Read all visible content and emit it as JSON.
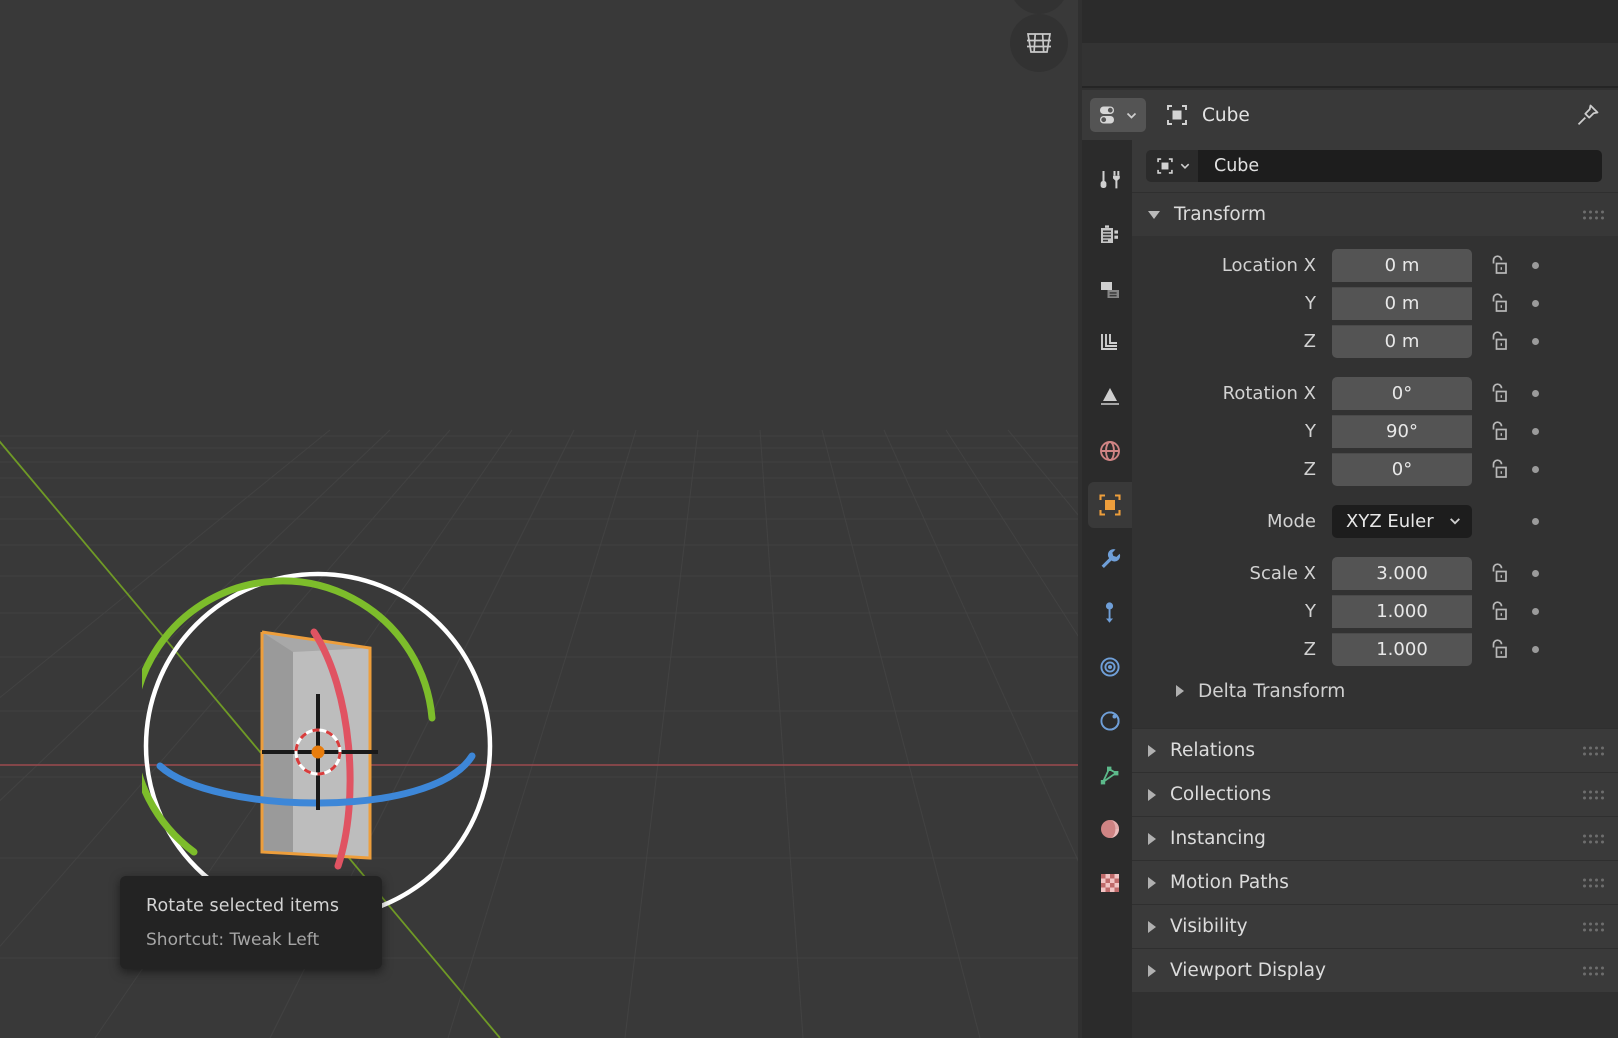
{
  "viewport": {
    "name": "3d-viewport",
    "background_color": "#393939",
    "grid_color": "#414141",
    "axis_x_color": "#9c4a4f",
    "axis_y_color": "#7aa32f",
    "gizmo": {
      "type": "rotate-gizmo",
      "outer_circle_color": "#ffffff",
      "arc_x_color": "#e05362",
      "arc_y_color": "#7dbd2b",
      "arc_z_color": "#3d87d8",
      "object_outline_color": "#ed9e3c",
      "object_fill_color": "#b0b0b0",
      "cursor_color": "#e87d0d"
    },
    "nav_icons": {
      "toggle_grid": "grid-icon",
      "zoom": "zoom-icon"
    }
  },
  "tooltip": {
    "title": "Rotate selected items",
    "shortcut": "Shortcut: Tweak Left"
  },
  "properties": {
    "editor_type_icon": "properties-editor-icon",
    "breadcrumb": {
      "object_icon": "object-icon",
      "object_name": "Cube"
    },
    "pin_icon": "pin-icon",
    "id_block": {
      "type_icon": "object-icon",
      "name": "Cube"
    },
    "tabs": [
      {
        "id": "tool",
        "icon": "tool-icon",
        "label": "Tool",
        "active": false,
        "color": "#d4d4d4"
      },
      {
        "id": "render",
        "icon": "render-icon",
        "label": "Render",
        "active": false,
        "color": "#d4d4d4"
      },
      {
        "id": "output",
        "icon": "output-printer-icon",
        "label": "Output",
        "active": false,
        "color": "#d4d4d4"
      },
      {
        "id": "view-layer",
        "icon": "view-layer-icon",
        "label": "View Layer",
        "active": false,
        "color": "#d4d4d4"
      },
      {
        "id": "scene",
        "icon": "scene-cone-icon",
        "label": "Scene",
        "active": false,
        "color": "#d4d4d4"
      },
      {
        "id": "world",
        "icon": "world-globe-icon",
        "label": "World",
        "active": false,
        "color": "#d08080"
      },
      {
        "id": "object",
        "icon": "object-square-icon",
        "label": "Object",
        "active": true,
        "color": "#ed9e3c"
      },
      {
        "id": "modifiers",
        "icon": "wrench-icon",
        "label": "Modifiers",
        "active": false,
        "color": "#6f9fd8"
      },
      {
        "id": "particles",
        "icon": "particles-icon",
        "label": "Particles",
        "active": false,
        "color": "#6f9fd8"
      },
      {
        "id": "physics",
        "icon": "physics-orbit-icon",
        "label": "Physics",
        "active": false,
        "color": "#6f9fd8"
      },
      {
        "id": "constraints",
        "icon": "constraints-icon",
        "label": "Constraints",
        "active": false,
        "color": "#6f9fd8"
      },
      {
        "id": "object-data",
        "icon": "mesh-data-icon",
        "label": "Object Data",
        "active": false,
        "color": "#5cb98a"
      },
      {
        "id": "material",
        "icon": "material-sphere-icon",
        "label": "Material",
        "active": false,
        "color": "#d08080"
      },
      {
        "id": "texture",
        "icon": "texture-checker-icon",
        "label": "Texture",
        "active": false,
        "color": "#d08080"
      }
    ],
    "panels": [
      {
        "id": "transform",
        "title": "Transform",
        "open": true,
        "groups": [
          {
            "id": "location",
            "rows": [
              {
                "label": "Location X",
                "value": "0 m",
                "lock": "unlocked-icon",
                "animate": true
              },
              {
                "label": "Y",
                "value": "0 m",
                "lock": "unlocked-icon",
                "animate": true
              },
              {
                "label": "Z",
                "value": "0 m",
                "lock": "unlocked-icon",
                "animate": true
              }
            ]
          },
          {
            "id": "rotation",
            "rows": [
              {
                "label": "Rotation X",
                "value": "0°",
                "lock": "unlocked-icon",
                "animate": true
              },
              {
                "label": "Y",
                "value": "90°",
                "lock": "unlocked-icon",
                "animate": true
              },
              {
                "label": "Z",
                "value": "0°",
                "lock": "unlocked-icon",
                "animate": true
              }
            ]
          },
          {
            "id": "rotation-mode",
            "rows": [
              {
                "label": "Mode",
                "value": "XYZ Euler",
                "dropdown": true,
                "animate": true
              }
            ]
          },
          {
            "id": "scale",
            "rows": [
              {
                "label": "Scale X",
                "value": "3.000",
                "lock": "unlocked-icon",
                "animate": true
              },
              {
                "label": "Y",
                "value": "1.000",
                "lock": "unlocked-icon",
                "animate": true
              },
              {
                "label": "Z",
                "value": "1.000",
                "lock": "unlocked-icon",
                "animate": true
              }
            ]
          }
        ],
        "subpanels": [
          {
            "id": "delta-transform",
            "title": "Delta Transform",
            "open": false
          }
        ]
      },
      {
        "id": "relations",
        "title": "Relations",
        "open": false
      },
      {
        "id": "collections",
        "title": "Collections",
        "open": false
      },
      {
        "id": "instancing",
        "title": "Instancing",
        "open": false
      },
      {
        "id": "motion-paths",
        "title": "Motion Paths",
        "open": false
      },
      {
        "id": "visibility",
        "title": "Visibility",
        "open": false
      },
      {
        "id": "viewport-display",
        "title": "Viewport Display",
        "open": false
      }
    ]
  }
}
